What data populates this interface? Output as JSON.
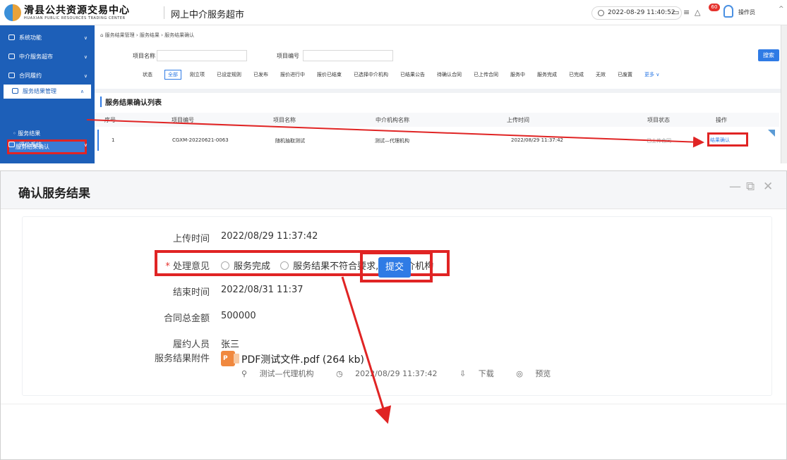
{
  "header": {
    "logo_cn": "滑县公共资源交易中心",
    "logo_en": "HUAXIAN PUBLIC RESOURCES TRADING CENTER",
    "app_title": "网上中介服务超市",
    "datetime": "2022-08-29 11:40:52",
    "notification_count": "60",
    "user_name": "操作员"
  },
  "sidebar": {
    "items": [
      "系统功能",
      "中介服务超市",
      "合同履约",
      "服务结果管理",
      "评价系统"
    ],
    "sub_items": [
      "服务结果",
      "服务结果确认"
    ]
  },
  "breadcrumb": "服务结果管理 › 服务结果 › 服务结果确认",
  "filter_form": {
    "project_name_label": "项目名称",
    "project_no_label": "项目编号",
    "search_label": "搜索",
    "status_label": "状态",
    "statuses": [
      "全部",
      "刚立项",
      "已设定规则",
      "已发布",
      "报价进行中",
      "报价已结束",
      "已选择中介机构",
      "已结果公告",
      "待确认合同",
      "已上传合同",
      "服务中",
      "服务完成",
      "已完成",
      "无效",
      "已废置"
    ],
    "more_label": "更多 ∨"
  },
  "list": {
    "title": "服务结果确认列表",
    "columns": [
      "序号",
      "项目编号",
      "项目名称",
      "中介机构名称",
      "上传时间",
      "项目状态",
      "操作"
    ],
    "rows": [
      {
        "no": "1",
        "code": "CGXM-20220621-0063",
        "name": "随机抽取测试",
        "agency": "测试—代理机构",
        "upload_time": "2022/08/29 11:37:42",
        "status": "已上传合同",
        "action": "结果确认"
      }
    ]
  },
  "dialog": {
    "title": "确认服务结果",
    "fields": {
      "upload_time_label": "上传时间",
      "upload_time": "2022/08/29 11:37:42",
      "required_mark": "*",
      "opinion_label": "处理意见",
      "opinion_options": [
        "服务完成",
        "服务结果不符合要求,退回中介机构"
      ],
      "end_time_label": "结束时间",
      "end_time": "2022/08/31 11:37",
      "contract_amount_label": "合同总金额",
      "contract_amount": "500000",
      "performer_label": "履约人员",
      "performer": "张三",
      "attachment_label": "服务结果附件"
    },
    "attachment": {
      "file_name": "PDF测试文件.pdf (264 kb)",
      "uploader": "测试—代理机构",
      "time": "2022/08/29 11:37:42",
      "download_label": "下载",
      "preview_label": "预览"
    },
    "submit_label": "提交"
  },
  "colors": {
    "primary": "#2f7be5",
    "sidebar": "#1d5fb8",
    "highlight": "#e02424"
  },
  "icons": [
    "clock-icon",
    "message-icon",
    "menu-icon",
    "bell-icon",
    "user-icon",
    "pdf-icon",
    "person-icon",
    "download-icon",
    "preview-icon"
  ]
}
